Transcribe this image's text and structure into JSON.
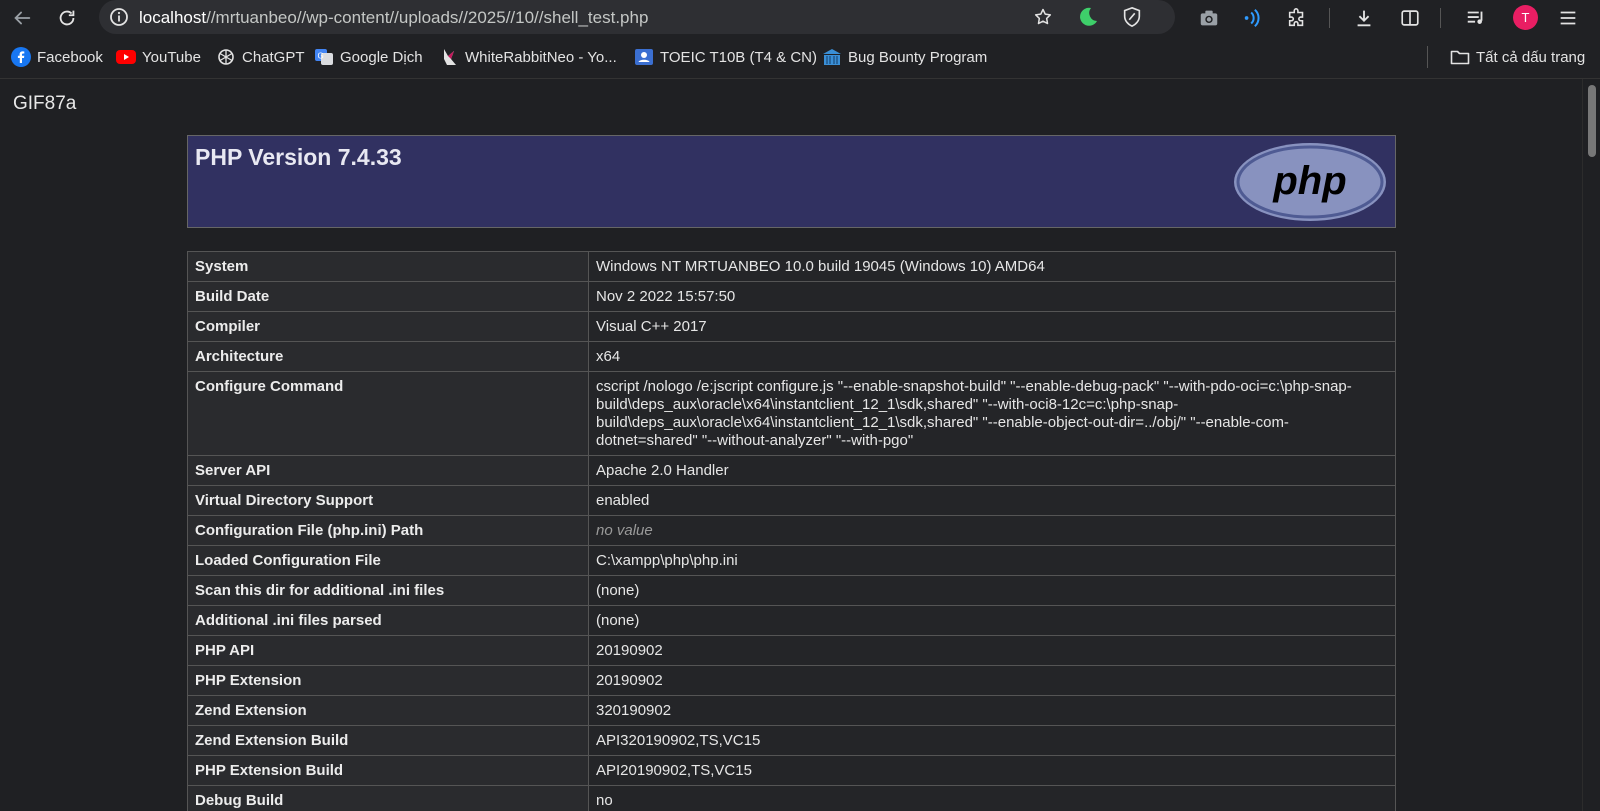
{
  "browser": {
    "url_host": "localhost",
    "url_path": "//mrtuanbeo//wp-content//uploads//2025//10//shell_test.php",
    "profile_initial": "T",
    "icons": [
      "back-icon",
      "reload-icon",
      "site-info-icon",
      "star-icon",
      "moon-extension-icon",
      "shield-extension-icon",
      "camera-icon",
      "wifi-extension-icon",
      "extensions-icon",
      "download-icon",
      "side-panel-icon",
      "reading-list-icon",
      "menu-icon"
    ]
  },
  "bookmarks": {
    "items": [
      {
        "label": "Facebook",
        "icon": "facebook-icon"
      },
      {
        "label": "YouTube",
        "icon": "youtube-icon"
      },
      {
        "label": "ChatGPT",
        "icon": "chatgpt-icon"
      },
      {
        "label": "Google Dịch",
        "icon": "google-translate-icon"
      },
      {
        "label": "WhiteRabbitNeo - Yo...",
        "icon": "rabbit-icon"
      },
      {
        "label": "TOEIC T10B (T4 & CN)",
        "icon": "contact-card-icon"
      },
      {
        "label": "Bug Bounty Program",
        "icon": "building-icon"
      }
    ],
    "all_bookmarks": "Tất cả dấu trang"
  },
  "page": {
    "gif_header": "GIF87a",
    "php_version": "PHP Version 7.4.33",
    "logo_text": "php",
    "rows": [
      {
        "key": "System",
        "value": "Windows NT MRTUANBEO 10.0 build 19045 (Windows 10) AMD64"
      },
      {
        "key": "Build Date",
        "value": "Nov 2 2022 15:57:50"
      },
      {
        "key": "Compiler",
        "value": "Visual C++ 2017"
      },
      {
        "key": "Architecture",
        "value": "x64"
      },
      {
        "key": "Configure Command",
        "value": "cscript /nologo /e:jscript configure.js \"--enable-snapshot-build\" \"--enable-debug-pack\" \"--with-pdo-oci=c:\\php-snap-build\\deps_aux\\oracle\\x64\\instantclient_12_1\\sdk,shared\" \"--with-oci8-12c=c:\\php-snap-build\\deps_aux\\oracle\\x64\\instantclient_12_1\\sdk,shared\" \"--enable-object-out-dir=../obj/\" \"--enable-com-dotnet=shared\" \"--without-analyzer\" \"--with-pgo\""
      },
      {
        "key": "Server API",
        "value": "Apache 2.0 Handler"
      },
      {
        "key": "Virtual Directory Support",
        "value": "enabled"
      },
      {
        "key": "Configuration File (php.ini) Path",
        "value": "no value",
        "novalue": true
      },
      {
        "key": "Loaded Configuration File",
        "value": "C:\\xampp\\php\\php.ini"
      },
      {
        "key": "Scan this dir for additional .ini files",
        "value": "(none)"
      },
      {
        "key": "Additional .ini files parsed",
        "value": "(none)"
      },
      {
        "key": "PHP API",
        "value": "20190902"
      },
      {
        "key": "PHP Extension",
        "value": "20190902"
      },
      {
        "key": "Zend Extension",
        "value": "320190902"
      },
      {
        "key": "Zend Extension Build",
        "value": "API320190902,TS,VC15"
      },
      {
        "key": "PHP Extension Build",
        "value": "API20190902,TS,VC15"
      },
      {
        "key": "Debug Build",
        "value": "no"
      }
    ]
  }
}
